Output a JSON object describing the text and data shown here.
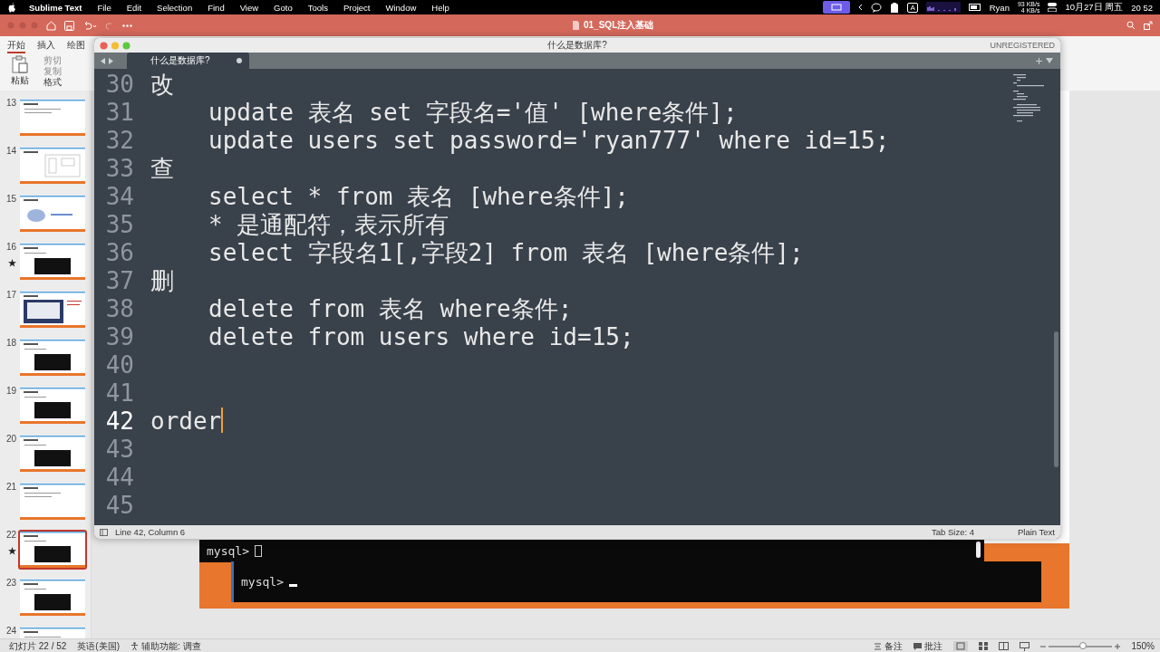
{
  "menubar": {
    "app": "Sublime Text",
    "menus": [
      "File",
      "Edit",
      "Selection",
      "Find",
      "View",
      "Goto",
      "Tools",
      "Project",
      "Window",
      "Help"
    ],
    "input_source": "A",
    "user": "Ryan",
    "upload_speed": "93 KB/s",
    "download_speed": "4 KB/s",
    "date": "10月27日 周五",
    "time": "20 52"
  },
  "presentation": {
    "title": "01_SQL注入基础",
    "ribbon_tabs": [
      {
        "label": "开始",
        "selected": true
      },
      {
        "label": "插入",
        "selected": false
      },
      {
        "label": "绘图",
        "selected": false
      }
    ],
    "paste_label": "粘贴",
    "clipboard_actions": [
      {
        "label": "剪切",
        "disabled": true
      },
      {
        "label": "复制",
        "disabled": true
      },
      {
        "label": "格式",
        "disabled": false
      }
    ],
    "slides": [
      {
        "number": "13",
        "kind": "text",
        "starred": false,
        "selected": false
      },
      {
        "number": "14",
        "kind": "diagram",
        "starred": false,
        "selected": false
      },
      {
        "number": "15",
        "kind": "picture",
        "starred": false,
        "selected": false
      },
      {
        "number": "16",
        "kind": "terminal",
        "starred": true,
        "selected": false
      },
      {
        "number": "17",
        "kind": "screenshot",
        "starred": false,
        "selected": false
      },
      {
        "number": "18",
        "kind": "terminal",
        "starred": false,
        "selected": false
      },
      {
        "number": "19",
        "kind": "terminal",
        "starred": false,
        "selected": false
      },
      {
        "number": "20",
        "kind": "terminal",
        "starred": false,
        "selected": false
      },
      {
        "number": "21",
        "kind": "text",
        "starred": false,
        "selected": false
      },
      {
        "number": "22",
        "kind": "terminal",
        "starred": true,
        "selected": true
      },
      {
        "number": "23",
        "kind": "terminal",
        "starred": false,
        "selected": false
      },
      {
        "number": "24",
        "kind": "text",
        "starred": false,
        "selected": false
      }
    ],
    "terminals": [
      {
        "prompt": "mysql>"
      },
      {
        "prompt": "mysql>"
      }
    ],
    "status_bar": {
      "slide_counter": "幻灯片 22 / 52",
      "language": "英语(美国)",
      "accessibility": "辅助功能: 调查",
      "notes": "备注",
      "comments": "批注",
      "zoom": {
        "level": 0.53,
        "reading": "150%"
      }
    }
  },
  "editor": {
    "window_title": "什么是数据库?",
    "license": "UNREGISTERED",
    "tab": {
      "label": "什么是数据库?",
      "modified": true
    },
    "lines": [
      {
        "number": "30",
        "text": "改",
        "indented": false,
        "current": false
      },
      {
        "number": "31",
        "text": "update 表名 set 字段名='值' [where条件];",
        "indented": true,
        "current": false
      },
      {
        "number": "32",
        "text": "update users set password='ryan777' where id=15;",
        "indented": true,
        "current": false
      },
      {
        "number": "33",
        "text": "查",
        "indented": false,
        "current": false
      },
      {
        "number": "34",
        "text": "select * from 表名 [where条件];",
        "indented": true,
        "current": false
      },
      {
        "number": "35",
        "text": "* 是通配符，表示所有",
        "indented": true,
        "current": false
      },
      {
        "number": "36",
        "text": "select 字段名1[,字段2] from 表名 [where条件];",
        "indented": true,
        "current": false
      },
      {
        "number": "37",
        "text": "删",
        "indented": false,
        "current": false
      },
      {
        "number": "38",
        "text": "delete from 表名 where条件;",
        "indented": true,
        "current": false
      },
      {
        "number": "39",
        "text": "delete from users where id=15;",
        "indented": true,
        "current": false
      },
      {
        "number": "40",
        "current": false
      },
      {
        "number": "41",
        "current": false
      },
      {
        "number": "42",
        "text": "order",
        "indented": false,
        "current": true
      },
      {
        "number": "43",
        "current": false
      },
      {
        "number": "44",
        "current": false
      },
      {
        "number": "45",
        "current": false
      }
    ],
    "status": {
      "position": "Line 42, Column 6",
      "tab_size": "Tab Size: 4",
      "syntax": "Plain Text"
    }
  }
}
